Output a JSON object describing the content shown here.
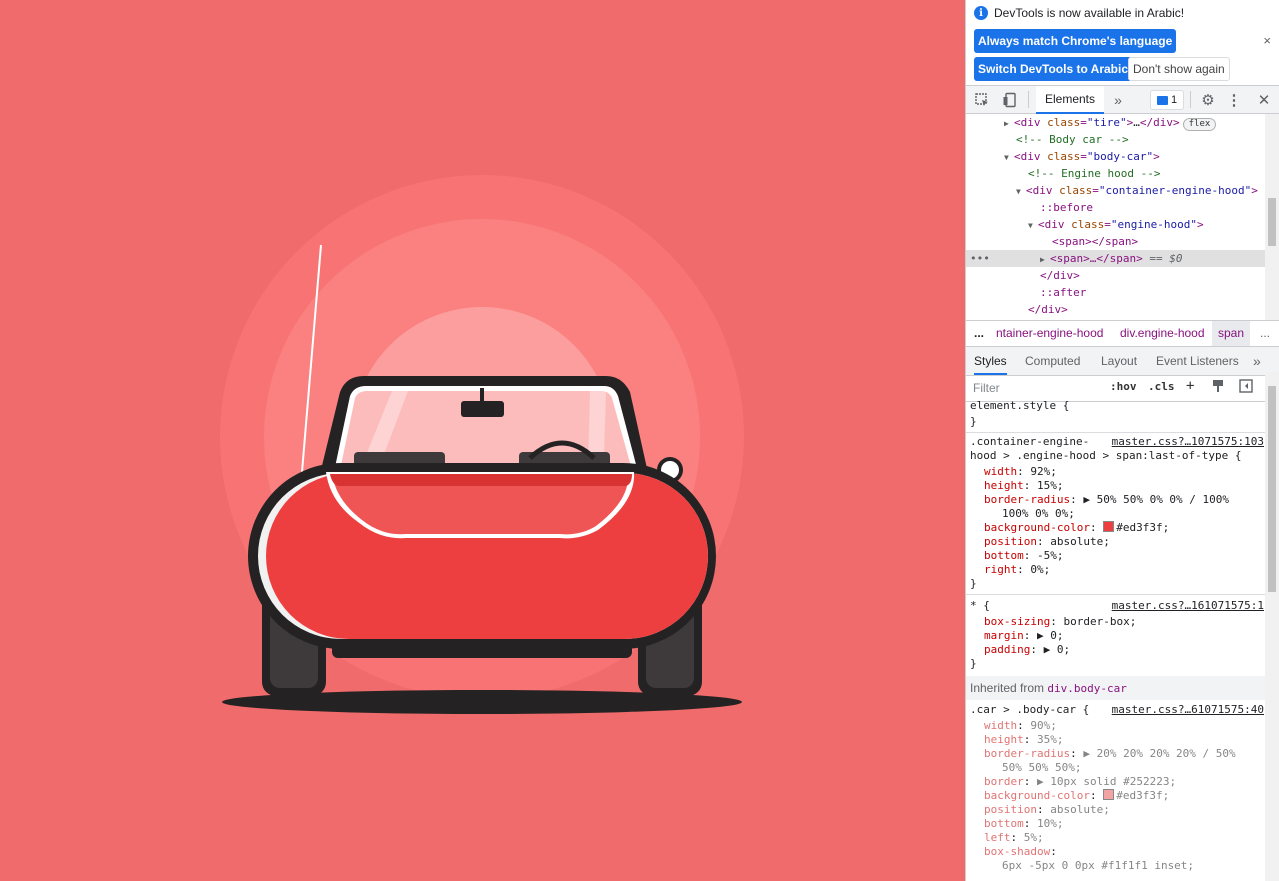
{
  "colors": {
    "page_bg": "#f06b6b",
    "car_red": "#ed3f3f",
    "car_outline": "#252223",
    "accent_blue": "#1a73e8"
  },
  "infobar": {
    "message": "DevTools is now available in Arabic!",
    "btn_match": "Always match Chrome's language",
    "btn_switch": "Switch DevTools to Arabic",
    "btn_dont_show": "Don't show again",
    "close": "×"
  },
  "toolbar": {
    "tab_elements": "Elements",
    "more_tabs": "»",
    "issues_count": "1"
  },
  "dom": {
    "lines": [
      {
        "indent": 3,
        "tri": "▶",
        "html": "tire",
        "kind": "div-collapsed"
      },
      {
        "indent": 4,
        "text": "<!-- Body car -->",
        "kind": "comment"
      },
      {
        "indent": 3,
        "tri": "▼",
        "html": "body-car",
        "kind": "div-open"
      },
      {
        "indent": 5,
        "text": "<!-- Engine hood -->",
        "kind": "comment"
      },
      {
        "indent": 4,
        "tri": "▼",
        "html": "container-engine-hood",
        "kind": "div-open"
      },
      {
        "indent": 6,
        "text": "::before",
        "kind": "pseudo"
      },
      {
        "indent": 5,
        "tri": "▼",
        "html": "engine-hood",
        "kind": "div-open"
      },
      {
        "indent": 7,
        "text": "<span></span>",
        "kind": "span"
      },
      {
        "indent": 6,
        "tri": "▶",
        "text": "<span>…</span>",
        "suffix": " == $0",
        "kind": "span-sel"
      },
      {
        "indent": 6,
        "text": "</div>",
        "kind": "close"
      },
      {
        "indent": 6,
        "text": "::after",
        "kind": "pseudo"
      },
      {
        "indent": 5,
        "text": "</div>",
        "kind": "close"
      }
    ],
    "flex_badge": "flex",
    "ellipsis": "…"
  },
  "breadcrumbs": {
    "more": "...",
    "items": [
      "ntainer-engine-hood",
      "div.engine-hood",
      "span"
    ],
    "trailing": "..."
  },
  "styles_tabs": [
    "Styles",
    "Computed",
    "Layout",
    "Event Listeners",
    "»"
  ],
  "filter": {
    "placeholder": "Filter",
    "hov": ":hov",
    "cls": ".cls",
    "plus": "+"
  },
  "styles": {
    "element_style": "element.style {",
    "close_brace": "}",
    "rule1": {
      "selector_a": ".container-engine-",
      "selector_b": "hood > .engine-hood > span:last-of-type {",
      "source": "master.css?…1071575:103",
      "props": [
        {
          "name": "width",
          "value": "92%;"
        },
        {
          "name": "height",
          "value": "15%;"
        },
        {
          "name": "border-radius",
          "value": "▶ 50% 50% 0% 0% / 100%"
        },
        {
          "name": "",
          "value": "100% 0% 0%;"
        },
        {
          "name": "background-color",
          "value": "#ed3f3f;",
          "swatch": "#ed3f3f"
        },
        {
          "name": "position",
          "value": "absolute;"
        },
        {
          "name": "bottom",
          "value": "-5%;"
        },
        {
          "name": "right",
          "value": "0%;"
        }
      ]
    },
    "rule2": {
      "selector": "* {",
      "source": "master.css?…161071575:1",
      "props": [
        {
          "name": "box-sizing",
          "value": "border-box;"
        },
        {
          "name": "margin",
          "value": "▶ 0;"
        },
        {
          "name": "padding",
          "value": "▶ 0;"
        }
      ]
    },
    "inherited_label": "Inherited from",
    "inherited_from": "div.body-car",
    "rule3": {
      "selector": ".car > .body-car {",
      "source": "master.css?…61071575:40",
      "props": [
        {
          "name": "width",
          "value": "90%;"
        },
        {
          "name": "height",
          "value": "35%;"
        },
        {
          "name": "border-radius",
          "value": "▶ 20% 20% 20% 20% / 50%"
        },
        {
          "name": "",
          "value": "50% 50% 50%;"
        },
        {
          "name": "border",
          "value": "▶ 10px solid #252223;",
          "swatch": "#808080"
        },
        {
          "name": "background-color",
          "value": "#ed3f3f;",
          "swatch": "#f4a3a3"
        },
        {
          "name": "position",
          "value": "absolute;"
        },
        {
          "name": "bottom",
          "value": "10%;"
        },
        {
          "name": "left",
          "value": "5%;"
        },
        {
          "name": "box-shadow",
          "value": ""
        },
        {
          "name": "",
          "value": "6px -5px 0 0px #f1f1f1 inset;"
        }
      ]
    }
  }
}
